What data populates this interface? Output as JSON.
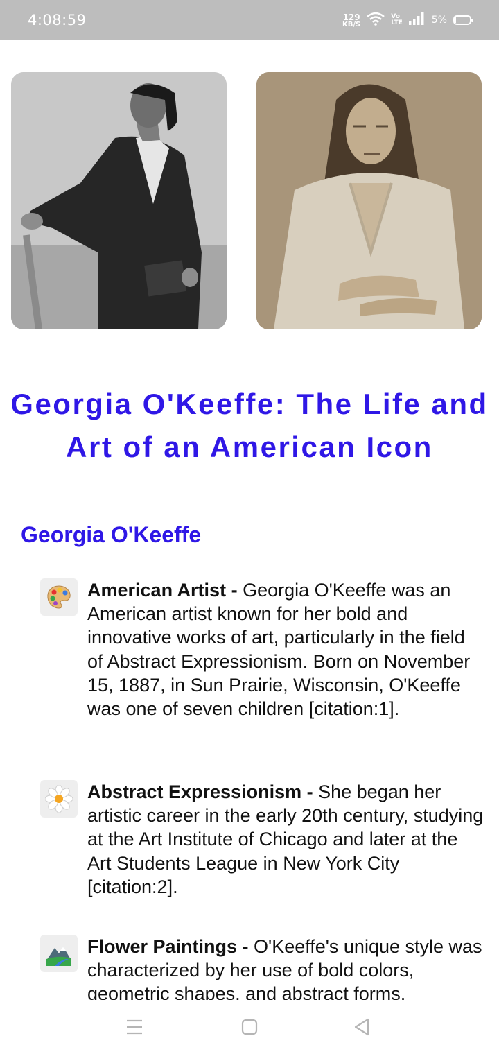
{
  "status_bar": {
    "time": "4:08:59",
    "net_speed_value": "129",
    "net_speed_unit": "KB/S",
    "volte_top": "Vo",
    "volte_bottom": "LTE",
    "battery_percent": "5%"
  },
  "photos": [
    {
      "name": "portrait-black-and-white"
    },
    {
      "name": "portrait-sepia"
    }
  ],
  "page": {
    "title": "Georgia O'Keeffe: The Life and Art of an American Icon",
    "section_title": "Georgia O'Keeffe"
  },
  "items": [
    {
      "icon": "artist-palette-icon",
      "heading": "American Artist",
      "separator": " - ",
      "body": "Georgia O'Keeffe was an American artist known for her bold and innovative works of art, particularly in the field of Abstract Expressionism. Born on November 15, 1887, in Sun Prairie, Wisconsin, O'Keeffe was one of seven children [citation:1]."
    },
    {
      "icon": "daisy-flower-icon",
      "heading": "Abstract Expressionism",
      "separator": " - ",
      "body": "She began her artistic career in the early 20th century, studying at the Art Institute of Chicago and later at the Art Students League in New York City [citation:2]."
    },
    {
      "icon": "mountain-landscape-icon",
      "heading": "Flower Paintings",
      "separator": " - ",
      "body": "O'Keeffe's unique style was characterized by her use of bold colors, geometric shapes, and abstract forms."
    }
  ],
  "colors": {
    "accent": "#2f17e6",
    "status_bar_bg": "#bdbdbd"
  }
}
